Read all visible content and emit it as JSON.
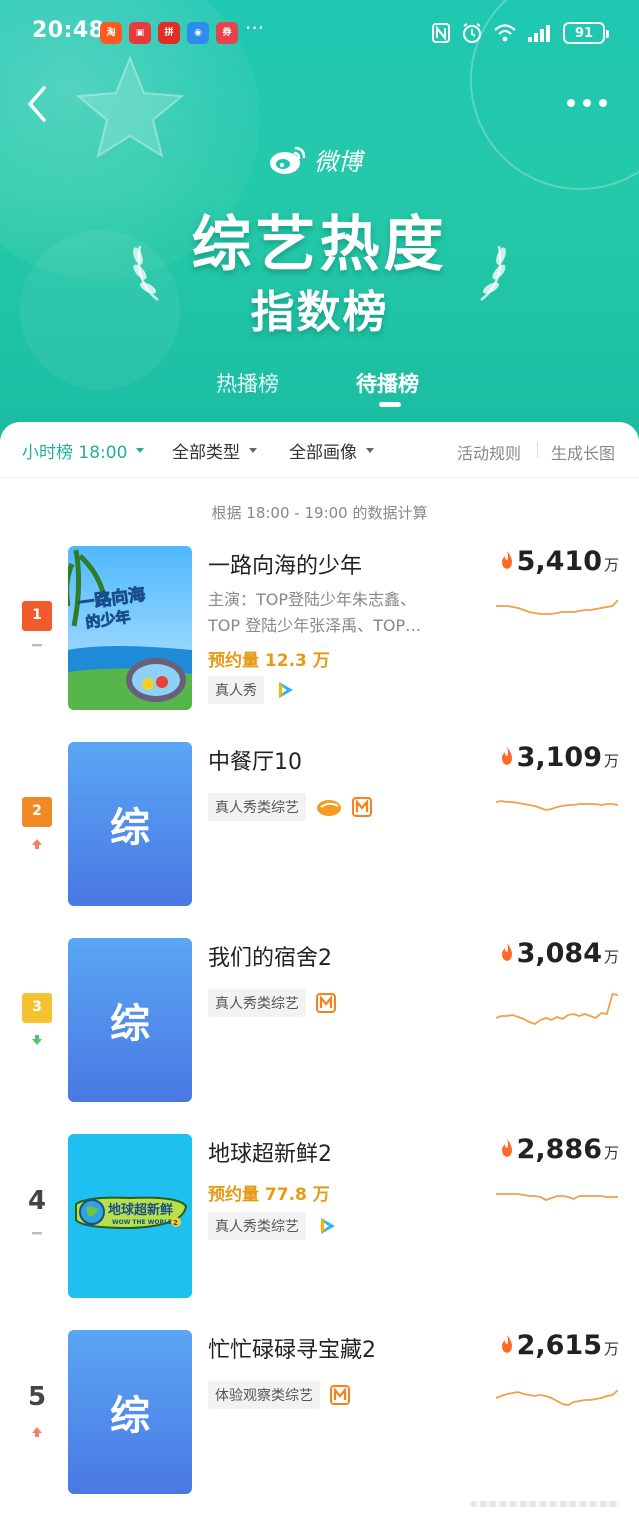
{
  "status_bar": {
    "time": "20:48",
    "notifications": [
      {
        "label": "淘",
        "color": "#ff5a1f"
      },
      {
        "label": "▣",
        "color": "#e73a3a"
      },
      {
        "label": "拼",
        "color": "#e02e24"
      },
      {
        "label": "◉",
        "color": "#2d8cf0"
      },
      {
        "label": "券",
        "color": "#e8434d"
      }
    ],
    "more": "···",
    "battery": "91"
  },
  "header": {
    "brand": "微博",
    "title_line1": "综艺热度",
    "title_line2": "指数榜",
    "tabs": [
      {
        "label": "热播榜",
        "active": false
      },
      {
        "label": "待播榜",
        "active": true
      }
    ]
  },
  "filters": {
    "time": "小时榜 18:00",
    "type": "全部类型",
    "portrait": "全部画像",
    "rules": "活动规则",
    "long_image": "生成长图"
  },
  "calc_note": "根据 18:00 - 19:00 的数据计算",
  "colors": {
    "accent": "#1fb0a0",
    "heat_icon": "#ff6a2b",
    "trend_line": "#f0a04a",
    "booking": "#e89a15"
  },
  "items": [
    {
      "rank": "1",
      "rank_color": "#ef5b2b",
      "trend": "flat",
      "name": "一路向海的少年",
      "cast": "主演：TOP登陆少年朱志鑫、TOP 登陆少年张泽禹、TOP…",
      "booking": "预约量 12.3 万",
      "tag": "真人秀",
      "platforms": [
        "tencent-video-icon"
      ],
      "heat": "5,410",
      "unit": "万",
      "poster": "image",
      "spark": [
        30,
        30,
        30,
        29,
        28,
        26,
        24,
        23,
        22,
        22,
        22,
        23,
        24,
        24,
        24,
        25,
        26,
        26,
        27,
        28,
        29,
        30,
        36
      ]
    },
    {
      "rank": "2",
      "rank_color": "#f08a24",
      "trend": "up",
      "name": "中餐厅10",
      "tag": "真人秀类综艺",
      "platforms": [
        "mango-egg-icon",
        "mango-tv-icon"
      ],
      "heat": "3,109",
      "unit": "万",
      "poster": "综",
      "spark": [
        30,
        31,
        30,
        30,
        29,
        28,
        27,
        26,
        24,
        22,
        23,
        25,
        26,
        27,
        27,
        28,
        28,
        28,
        28,
        27,
        28,
        28,
        27
      ]
    },
    {
      "rank": "3",
      "rank_color": "#f6c330",
      "trend": "down",
      "name": "我们的宿舍2",
      "tag": "真人秀类综艺",
      "platforms": [
        "mango-tv-icon"
      ],
      "heat": "3,084",
      "unit": "万",
      "poster": "综",
      "spark": [
        10,
        12,
        12,
        13,
        11,
        9,
        6,
        4,
        8,
        10,
        8,
        11,
        9,
        13,
        14,
        12,
        14,
        12,
        10,
        15,
        14,
        34,
        33
      ]
    },
    {
      "rank": "4",
      "rank_color": "",
      "trend": "flat",
      "name": "地球超新鲜2",
      "booking": "预约量 77.8 万",
      "tag": "真人秀类综艺",
      "platforms": [
        "tencent-video-icon"
      ],
      "heat": "2,886",
      "unit": "万",
      "poster": "image",
      "spark": [
        30,
        30,
        30,
        30,
        30,
        29,
        28,
        28,
        27,
        24,
        26,
        28,
        28,
        27,
        25,
        28,
        28,
        28,
        28,
        28,
        27,
        27,
        27
      ]
    },
    {
      "rank": "5",
      "rank_color": "",
      "trend": "up",
      "name": "忙忙碌碌寻宝藏2",
      "tag": "体验观察类综艺",
      "platforms": [
        "mango-tv-icon"
      ],
      "heat": "2,615",
      "unit": "万",
      "poster": "综",
      "spark": [
        22,
        24,
        26,
        27,
        28,
        26,
        25,
        24,
        25,
        24,
        22,
        19,
        16,
        15,
        18,
        19,
        20,
        20,
        21,
        22,
        24,
        25,
        30
      ]
    }
  ]
}
